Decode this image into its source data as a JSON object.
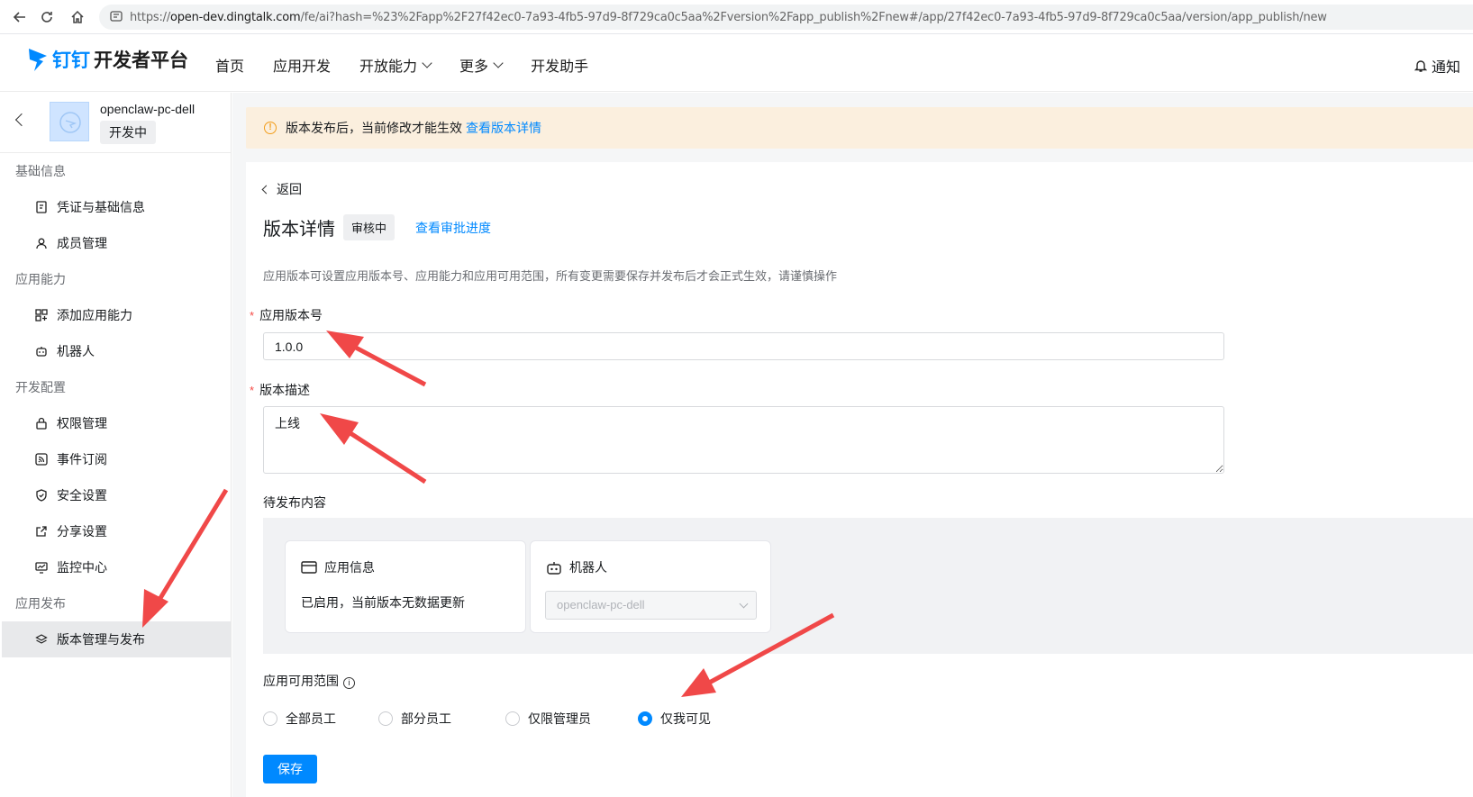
{
  "browser": {
    "url_prefix": "https://",
    "url_host": "open-dev.dingtalk.com",
    "url_rest": "/fe/ai?hash=%23%2Fapp%2F27f42ec0-7a93-4fb5-97d9-8f729ca0c5aa%2Fversion%2Fapp_publish%2Fnew#/app/27f42ec0-7a93-4fb5-97d9-8f729ca0c5aa/version/app_publish/new"
  },
  "header": {
    "brand": "钉钉",
    "product": "开发者平台",
    "nav": [
      {
        "label": "首页"
      },
      {
        "label": "应用开发"
      },
      {
        "label": "开放能力"
      },
      {
        "label": "更多"
      },
      {
        "label": "开发助手"
      }
    ],
    "notify": "通知"
  },
  "sidebar": {
    "app_name": "openclaw-pc-dell",
    "app_status": "开发中",
    "sections": [
      {
        "title": "基础信息",
        "items": [
          {
            "label": "凭证与基础信息",
            "icon": "credential-icon"
          },
          {
            "label": "成员管理",
            "icon": "user-icon"
          }
        ]
      },
      {
        "title": "应用能力",
        "items": [
          {
            "label": "添加应用能力",
            "icon": "apps-icon"
          },
          {
            "label": "机器人",
            "icon": "robot-icon"
          }
        ]
      },
      {
        "title": "开发配置",
        "items": [
          {
            "label": "权限管理",
            "icon": "lock-icon"
          },
          {
            "label": "事件订阅",
            "icon": "rss-icon"
          },
          {
            "label": "安全设置",
            "icon": "shield-icon"
          },
          {
            "label": "分享设置",
            "icon": "share-icon"
          },
          {
            "label": "监控中心",
            "icon": "monitor-icon"
          }
        ]
      },
      {
        "title": "应用发布",
        "items": [
          {
            "label": "版本管理与发布",
            "icon": "layers-icon",
            "active": true
          }
        ]
      }
    ]
  },
  "alert": {
    "text": "版本发布后，当前修改才能生效",
    "link": "查看版本详情"
  },
  "detail": {
    "back": "返回",
    "title": "版本详情",
    "status": "审核中",
    "progress_link": "查看审批进度",
    "description": "应用版本可设置应用版本号、应用能力和应用可用范围，所有变更需要保存并发布后才会正式生效，请谨慎操作",
    "version_label": "应用版本号",
    "version_value": "1.0.0",
    "desc_label": "版本描述",
    "desc_value": "上线",
    "pending_label": "待发布内容",
    "card_info_title": "应用信息",
    "card_info_text": "已启用，当前版本无数据更新",
    "card_robot_title": "机器人",
    "card_robot_select": "openclaw-pc-dell",
    "scope_label": "应用可用范围",
    "scope_options": [
      {
        "label": "全部员工",
        "checked": false
      },
      {
        "label": "部分员工",
        "checked": false
      },
      {
        "label": "仅限管理员",
        "checked": false
      },
      {
        "label": "仅我可见",
        "checked": true
      }
    ],
    "save": "保存"
  },
  "colors": {
    "accent": "#0089ff",
    "alert_bg": "#fbefde",
    "annotation_arrow": "#f04848"
  }
}
